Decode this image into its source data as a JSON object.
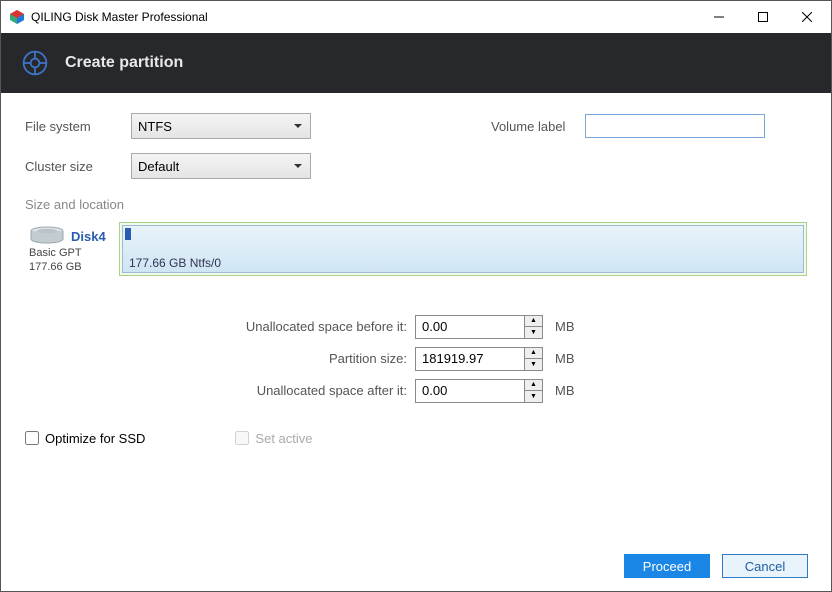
{
  "window": {
    "title": "QILING Disk Master Professional"
  },
  "header": {
    "title": "Create partition"
  },
  "labels": {
    "file_system": "File system",
    "cluster_size": "Cluster size",
    "volume_label": "Volume label",
    "size_location": "Size and location",
    "unalloc_before": "Unallocated space before it:",
    "partition_size": "Partition size:",
    "unalloc_after": "Unallocated space after it:",
    "optimize_ssd": "Optimize for SSD",
    "set_active": "Set active",
    "proceed": "Proceed",
    "cancel": "Cancel",
    "mb": "MB"
  },
  "values": {
    "file_system": "NTFS",
    "cluster_size": "Default",
    "volume_label": "",
    "unalloc_before": "0.00",
    "partition_size": "181919.97",
    "unalloc_after": "0.00"
  },
  "disk": {
    "name": "Disk4",
    "type": "Basic GPT",
    "size": "177.66 GB",
    "bar_label": "177.66 GB Ntfs/0"
  }
}
